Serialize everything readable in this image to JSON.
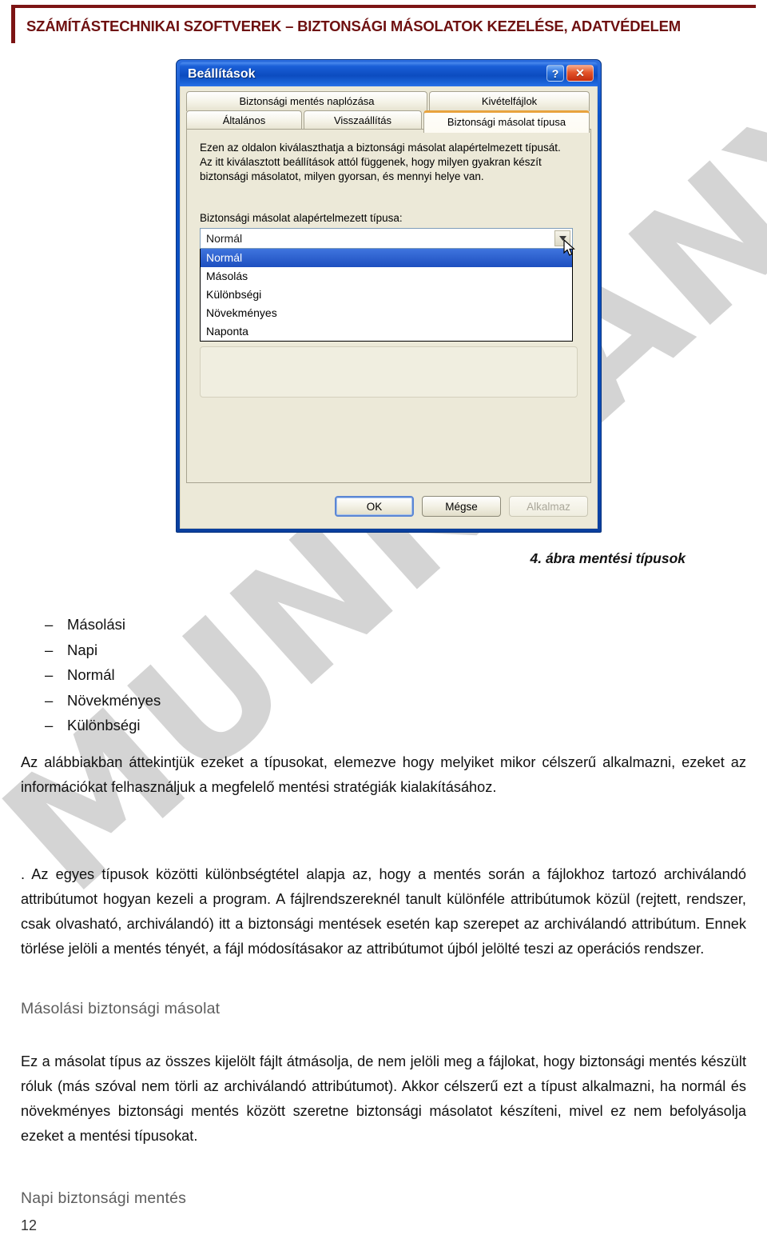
{
  "header": {
    "running_title": "SZÁMÍTÁSTECHNIKAI SZOFTVEREK – BIZTONSÁGI MÁSOLATOK KEZELÉSE, ADATVÉDELEM",
    "accent_color": "#7c1414"
  },
  "watermark": {
    "text": "MUNKAANYAG",
    "color": "#d2d2d2"
  },
  "dialog": {
    "title": "Beállítások",
    "help_button": "?",
    "close_button": "✕",
    "tabs_row1": [
      {
        "label": "Biztonsági mentés naplózása",
        "active": false
      },
      {
        "label": "Kivételfájlok",
        "active": false
      }
    ],
    "tabs_row2": [
      {
        "label": "Általános",
        "active": false
      },
      {
        "label": "Visszaállítás",
        "active": false
      },
      {
        "label": "Biztonsági másolat típusa",
        "active": true
      }
    ],
    "description": "Ezen az oldalon kiválaszthatja a biztonsági másolat alapértelmezett típusát. Az itt kiválasztott beállítások attól függenek, hogy milyen gyakran készít biztonsági másolatot, milyen gyorsan, és mennyi helye van.",
    "combo_label": "Biztonsági másolat alapértelmezett típusa:",
    "combo_value": "Normál",
    "combo_options": [
      {
        "label": "Normál",
        "selected": true
      },
      {
        "label": "Másolás",
        "selected": false
      },
      {
        "label": "Különbségi",
        "selected": false
      },
      {
        "label": "Növekményes",
        "selected": false
      },
      {
        "label": "Naponta",
        "selected": false
      }
    ],
    "buttons": [
      {
        "label": "OK",
        "state": "default"
      },
      {
        "label": "Mégse",
        "state": "normal"
      },
      {
        "label": "Alkalmaz",
        "state": "disabled"
      }
    ],
    "titlebar_color": "#0a52c8",
    "highlight_color": "#1a4fc4",
    "active_tab_accent": "#e8a33d"
  },
  "document": {
    "figure_caption": "4. ábra mentési típusok",
    "list_items": [
      {
        "dash": "–",
        "label": "Másolási"
      },
      {
        "dash": "–",
        "label": "Napi"
      },
      {
        "dash": "–",
        "label": "Normál"
      },
      {
        "dash": "–",
        "label": "Növekményes"
      },
      {
        "dash": "–",
        "label": "Különbségi"
      }
    ],
    "paragraph_1": "Az alábbiakban áttekintjük ezeket a típusokat, elemezve hogy melyiket mikor célszerű alkalmazni, ezeket az információkat felhasználjuk a megfelelő mentési stratégiák kialakításához.",
    "paragraph_2": ". Az egyes típusok közötti különbségtétel alapja az, hogy a mentés során a fájlokhoz tartozó archiválandó attribútumot hogyan kezeli a program. A fájlrendszereknél tanult különféle attribútumok közül (rejtett, rendszer, csak olvasható, archiválandó) itt a biztonsági mentések esetén kap szerepet az archiválandó attribútum. Ennek törlése jelöli a mentés tényét, a fájl módosításakor az attribútumot újból jelölté teszi az operációs rendszer.",
    "heading_1": "Másolási biztonsági másolat",
    "paragraph_3": "Ez a másolat típus az összes kijelölt fájlt átmásolja, de nem jelöli meg a fájlokat, hogy biztonsági mentés készült róluk (más szóval nem törli az archiválandó attribútumot). Akkor célszerű ezt a típust alkalmazni, ha normál és növekményes biztonsági mentés között szeretne biztonsági másolatot készíteni, mivel ez nem befolyásolja ezeket a mentési típusokat.",
    "heading_2": "Napi biztonsági mentés",
    "page_number": "12"
  }
}
